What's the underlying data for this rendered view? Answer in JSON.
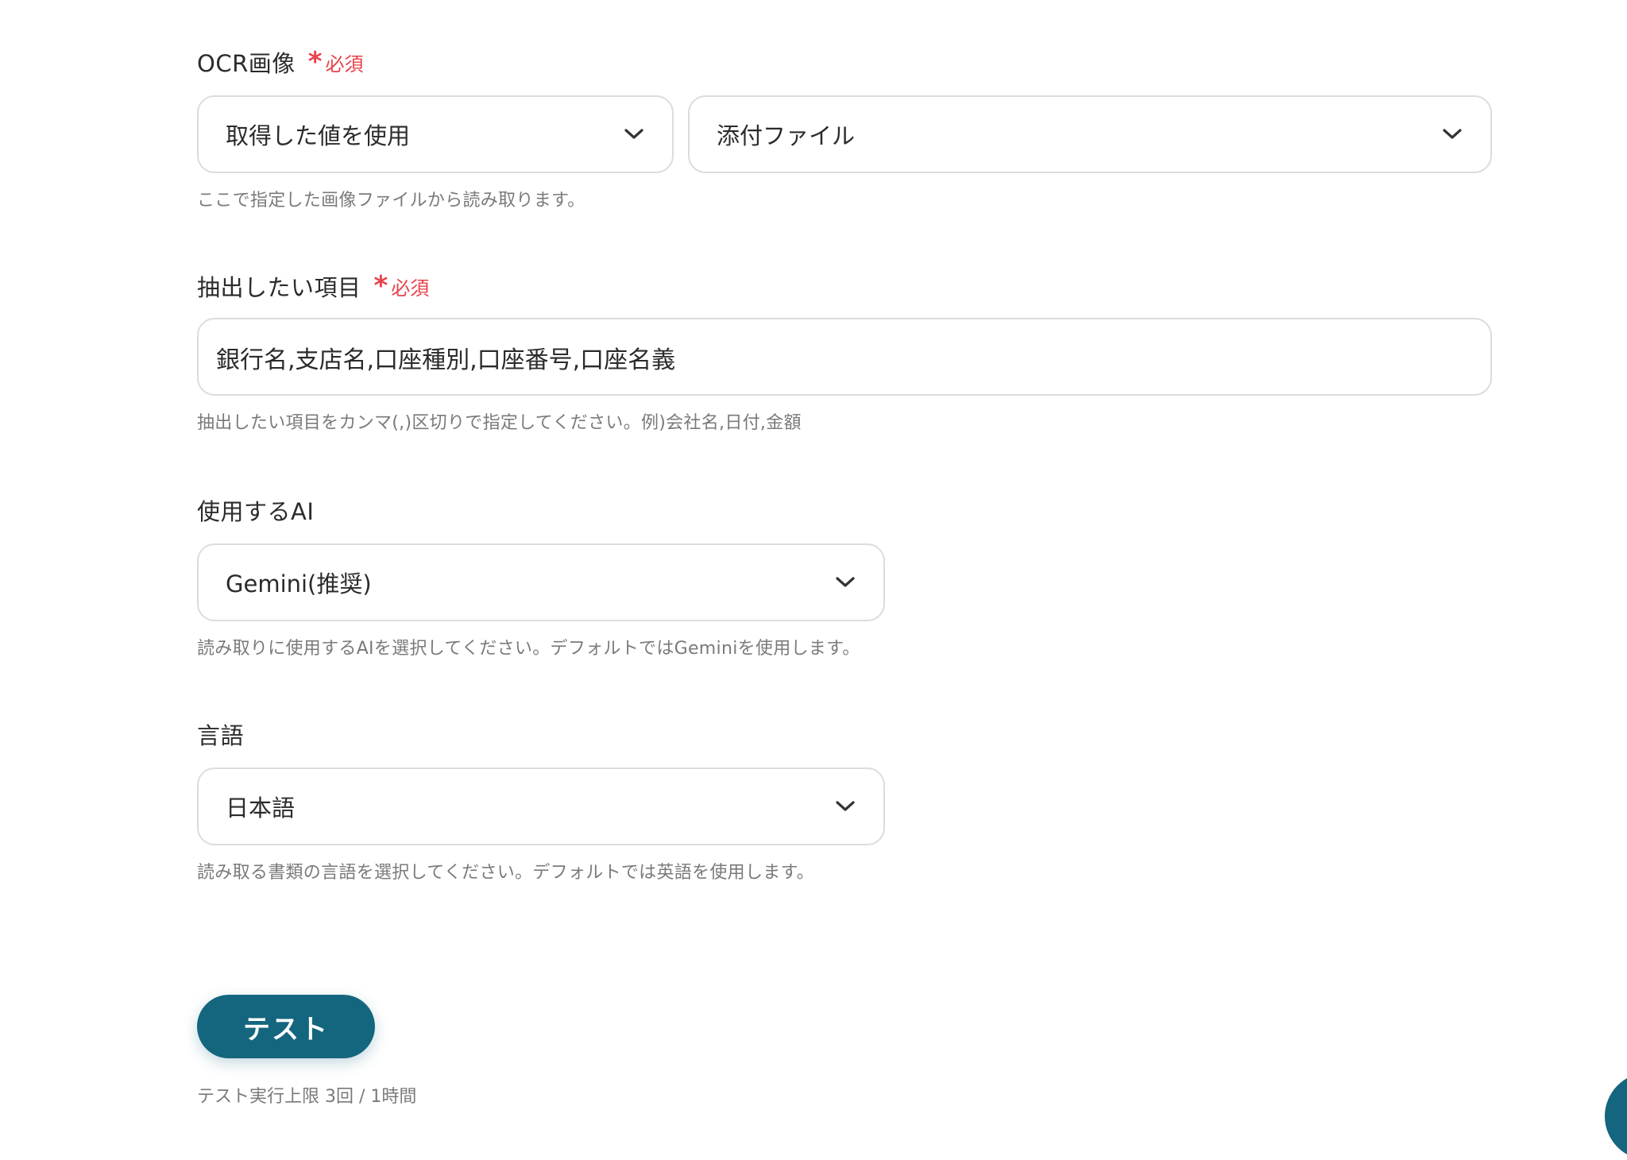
{
  "ocr_image": {
    "label": "OCR画像",
    "required": "必須",
    "source_select": "取得した値を使用",
    "file_select": "添付ファイル",
    "help": "ここで指定した画像ファイルから読み取ります。"
  },
  "extract_items": {
    "label": "抽出したい項目",
    "required": "必須",
    "value": "銀行名,支店名,口座種別,口座番号,口座名義",
    "help": "抽出したい項目をカンマ(,)区切りで指定してください。例)会社名,日付,金額"
  },
  "ai_model": {
    "label": "使用するAI",
    "selected": "Gemini(推奨)",
    "help": "読み取りに使用するAIを選択してください。デフォルトではGeminiを使用します。"
  },
  "language": {
    "label": "言語",
    "selected": "日本語",
    "help": "読み取る書類の言語を選択してください。デフォルトでは英語を使用します。"
  },
  "test": {
    "button_label": "テスト",
    "limit_text": "テスト実行上限 3回 / 1時間"
  },
  "colors": {
    "required": "#e8424b",
    "primary": "#14667f",
    "border": "#dcdcdc",
    "help_text": "#7a7a7a"
  },
  "icons": {
    "dropdown": "chevron-down-icon",
    "required_marker": "asterisk-icon"
  }
}
